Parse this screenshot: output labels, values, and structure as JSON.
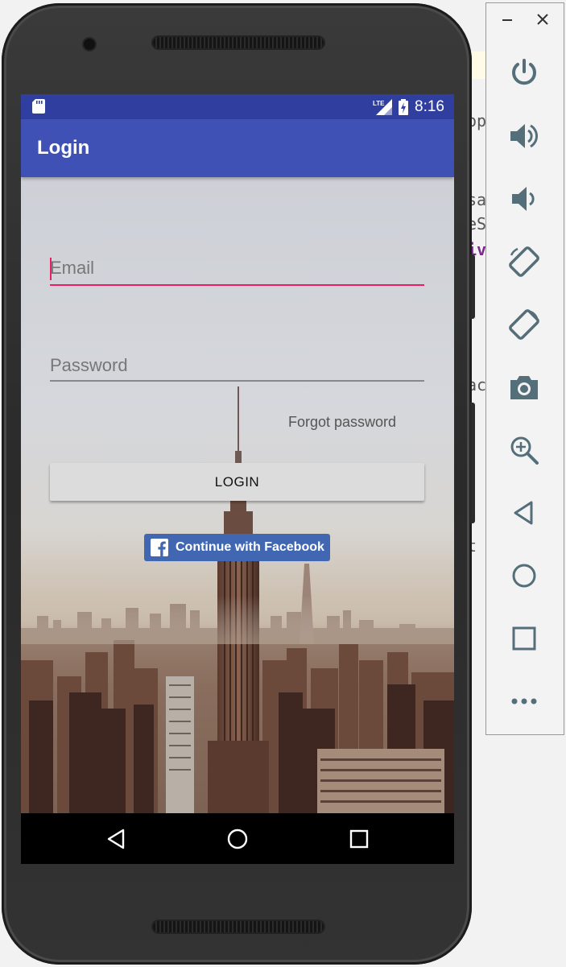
{
  "status_bar": {
    "network": "LTE",
    "time": "8:16",
    "sd_icon": "sd-card-icon",
    "signal_icon": "signal-icon",
    "battery_icon": "battery-charging-icon"
  },
  "app_bar": {
    "title": "Login"
  },
  "login_form": {
    "email_placeholder": "Email",
    "password_placeholder": "Password",
    "forgot_password": "Forgot password",
    "login_button": "LOGIN",
    "facebook_button": "Continue with Facebook"
  },
  "nav_bar": {
    "icons": [
      "back-icon",
      "home-icon",
      "recents-icon"
    ]
  },
  "emulator_toolbar": {
    "window_icons": [
      "minimize-icon",
      "close-icon"
    ],
    "icons": [
      "power-icon",
      "volume-up-icon",
      "volume-down-icon",
      "rotate-left-icon",
      "rotate-right-icon",
      "camera-icon",
      "zoom-icon",
      "back-icon",
      "home-icon",
      "overview-icon",
      "more-icon"
    ]
  },
  "colors": {
    "status_bar": "#303f9f",
    "app_bar": "#3f51b5",
    "accent": "#e91e63",
    "facebook": "#4267b2"
  }
}
